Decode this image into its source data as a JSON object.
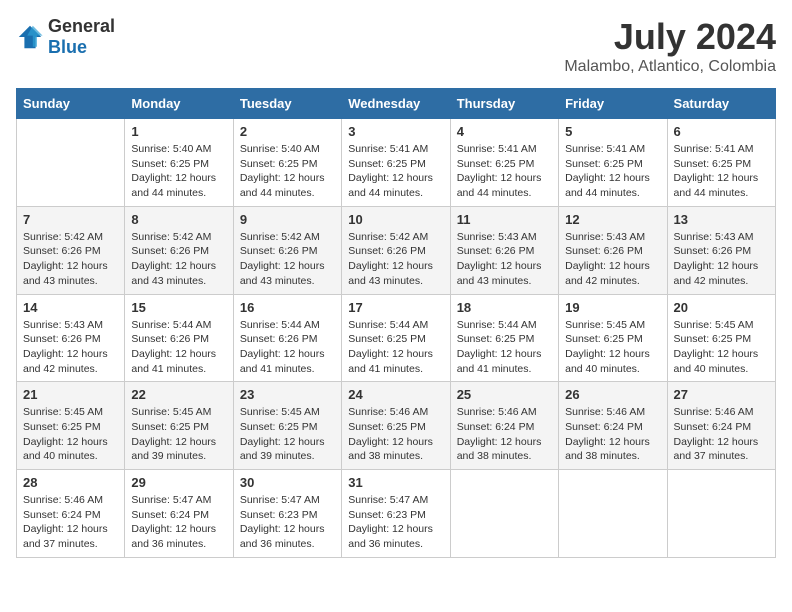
{
  "logo": {
    "general": "General",
    "blue": "Blue"
  },
  "title": "July 2024",
  "subtitle": "Malambo, Atlantico, Colombia",
  "days_header": [
    "Sunday",
    "Monday",
    "Tuesday",
    "Wednesday",
    "Thursday",
    "Friday",
    "Saturday"
  ],
  "weeks": [
    [
      {
        "day": "",
        "sunrise": "",
        "sunset": "",
        "daylight": ""
      },
      {
        "day": "1",
        "sunrise": "Sunrise: 5:40 AM",
        "sunset": "Sunset: 6:25 PM",
        "daylight": "Daylight: 12 hours and 44 minutes."
      },
      {
        "day": "2",
        "sunrise": "Sunrise: 5:40 AM",
        "sunset": "Sunset: 6:25 PM",
        "daylight": "Daylight: 12 hours and 44 minutes."
      },
      {
        "day": "3",
        "sunrise": "Sunrise: 5:41 AM",
        "sunset": "Sunset: 6:25 PM",
        "daylight": "Daylight: 12 hours and 44 minutes."
      },
      {
        "day": "4",
        "sunrise": "Sunrise: 5:41 AM",
        "sunset": "Sunset: 6:25 PM",
        "daylight": "Daylight: 12 hours and 44 minutes."
      },
      {
        "day": "5",
        "sunrise": "Sunrise: 5:41 AM",
        "sunset": "Sunset: 6:25 PM",
        "daylight": "Daylight: 12 hours and 44 minutes."
      },
      {
        "day": "6",
        "sunrise": "Sunrise: 5:41 AM",
        "sunset": "Sunset: 6:25 PM",
        "daylight": "Daylight: 12 hours and 44 minutes."
      }
    ],
    [
      {
        "day": "7",
        "sunrise": "Sunrise: 5:42 AM",
        "sunset": "Sunset: 6:26 PM",
        "daylight": "Daylight: 12 hours and 43 minutes."
      },
      {
        "day": "8",
        "sunrise": "Sunrise: 5:42 AM",
        "sunset": "Sunset: 6:26 PM",
        "daylight": "Daylight: 12 hours and 43 minutes."
      },
      {
        "day": "9",
        "sunrise": "Sunrise: 5:42 AM",
        "sunset": "Sunset: 6:26 PM",
        "daylight": "Daylight: 12 hours and 43 minutes."
      },
      {
        "day": "10",
        "sunrise": "Sunrise: 5:42 AM",
        "sunset": "Sunset: 6:26 PM",
        "daylight": "Daylight: 12 hours and 43 minutes."
      },
      {
        "day": "11",
        "sunrise": "Sunrise: 5:43 AM",
        "sunset": "Sunset: 6:26 PM",
        "daylight": "Daylight: 12 hours and 43 minutes."
      },
      {
        "day": "12",
        "sunrise": "Sunrise: 5:43 AM",
        "sunset": "Sunset: 6:26 PM",
        "daylight": "Daylight: 12 hours and 42 minutes."
      },
      {
        "day": "13",
        "sunrise": "Sunrise: 5:43 AM",
        "sunset": "Sunset: 6:26 PM",
        "daylight": "Daylight: 12 hours and 42 minutes."
      }
    ],
    [
      {
        "day": "14",
        "sunrise": "Sunrise: 5:43 AM",
        "sunset": "Sunset: 6:26 PM",
        "daylight": "Daylight: 12 hours and 42 minutes."
      },
      {
        "day": "15",
        "sunrise": "Sunrise: 5:44 AM",
        "sunset": "Sunset: 6:26 PM",
        "daylight": "Daylight: 12 hours and 41 minutes."
      },
      {
        "day": "16",
        "sunrise": "Sunrise: 5:44 AM",
        "sunset": "Sunset: 6:26 PM",
        "daylight": "Daylight: 12 hours and 41 minutes."
      },
      {
        "day": "17",
        "sunrise": "Sunrise: 5:44 AM",
        "sunset": "Sunset: 6:25 PM",
        "daylight": "Daylight: 12 hours and 41 minutes."
      },
      {
        "day": "18",
        "sunrise": "Sunrise: 5:44 AM",
        "sunset": "Sunset: 6:25 PM",
        "daylight": "Daylight: 12 hours and 41 minutes."
      },
      {
        "day": "19",
        "sunrise": "Sunrise: 5:45 AM",
        "sunset": "Sunset: 6:25 PM",
        "daylight": "Daylight: 12 hours and 40 minutes."
      },
      {
        "day": "20",
        "sunrise": "Sunrise: 5:45 AM",
        "sunset": "Sunset: 6:25 PM",
        "daylight": "Daylight: 12 hours and 40 minutes."
      }
    ],
    [
      {
        "day": "21",
        "sunrise": "Sunrise: 5:45 AM",
        "sunset": "Sunset: 6:25 PM",
        "daylight": "Daylight: 12 hours and 40 minutes."
      },
      {
        "day": "22",
        "sunrise": "Sunrise: 5:45 AM",
        "sunset": "Sunset: 6:25 PM",
        "daylight": "Daylight: 12 hours and 39 minutes."
      },
      {
        "day": "23",
        "sunrise": "Sunrise: 5:45 AM",
        "sunset": "Sunset: 6:25 PM",
        "daylight": "Daylight: 12 hours and 39 minutes."
      },
      {
        "day": "24",
        "sunrise": "Sunrise: 5:46 AM",
        "sunset": "Sunset: 6:25 PM",
        "daylight": "Daylight: 12 hours and 38 minutes."
      },
      {
        "day": "25",
        "sunrise": "Sunrise: 5:46 AM",
        "sunset": "Sunset: 6:24 PM",
        "daylight": "Daylight: 12 hours and 38 minutes."
      },
      {
        "day": "26",
        "sunrise": "Sunrise: 5:46 AM",
        "sunset": "Sunset: 6:24 PM",
        "daylight": "Daylight: 12 hours and 38 minutes."
      },
      {
        "day": "27",
        "sunrise": "Sunrise: 5:46 AM",
        "sunset": "Sunset: 6:24 PM",
        "daylight": "Daylight: 12 hours and 37 minutes."
      }
    ],
    [
      {
        "day": "28",
        "sunrise": "Sunrise: 5:46 AM",
        "sunset": "Sunset: 6:24 PM",
        "daylight": "Daylight: 12 hours and 37 minutes."
      },
      {
        "day": "29",
        "sunrise": "Sunrise: 5:47 AM",
        "sunset": "Sunset: 6:24 PM",
        "daylight": "Daylight: 12 hours and 36 minutes."
      },
      {
        "day": "30",
        "sunrise": "Sunrise: 5:47 AM",
        "sunset": "Sunset: 6:23 PM",
        "daylight": "Daylight: 12 hours and 36 minutes."
      },
      {
        "day": "31",
        "sunrise": "Sunrise: 5:47 AM",
        "sunset": "Sunset: 6:23 PM",
        "daylight": "Daylight: 12 hours and 36 minutes."
      },
      {
        "day": "",
        "sunrise": "",
        "sunset": "",
        "daylight": ""
      },
      {
        "day": "",
        "sunrise": "",
        "sunset": "",
        "daylight": ""
      },
      {
        "day": "",
        "sunrise": "",
        "sunset": "",
        "daylight": ""
      }
    ]
  ]
}
